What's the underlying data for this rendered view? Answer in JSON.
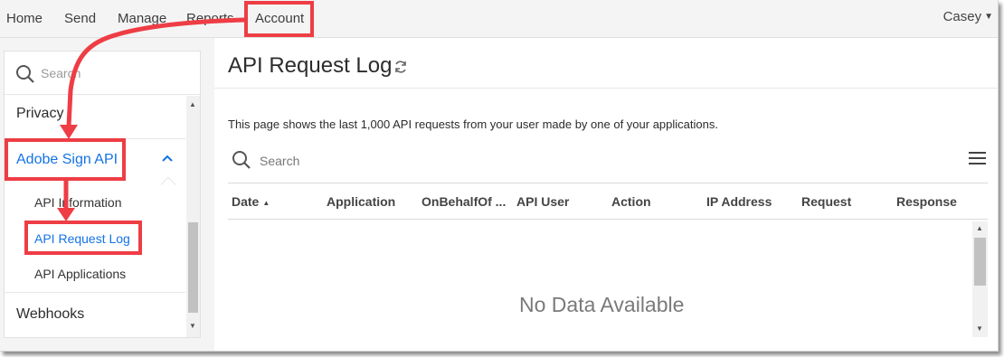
{
  "nav": {
    "items": [
      "Home",
      "Send",
      "Manage",
      "Reports",
      "Account"
    ],
    "user": "Casey"
  },
  "sidebar": {
    "search_placeholder": "Search",
    "items": [
      {
        "label": "Privacy"
      },
      {
        "label": "Adobe Sign API",
        "expanded": true,
        "children": [
          "API Information",
          "API Request Log",
          "API Applications"
        ]
      },
      {
        "label": "Webhooks"
      }
    ],
    "active_child": "API Request Log"
  },
  "main": {
    "title": "API Request Log",
    "description": "This page shows the last 1,000 API requests from your user made by one of your applications.",
    "search_placeholder": "Search",
    "columns": [
      "Date",
      "Application",
      "OnBehalfOf ...",
      "API User",
      "Action",
      "IP Address",
      "Request",
      "Response"
    ],
    "sort_column": "Date",
    "sort_direction": "ascending",
    "empty_text": "No Data Available"
  },
  "colors": {
    "accent": "#1473e6",
    "callout": "#ee3d45",
    "background": "#f4f4f4"
  }
}
